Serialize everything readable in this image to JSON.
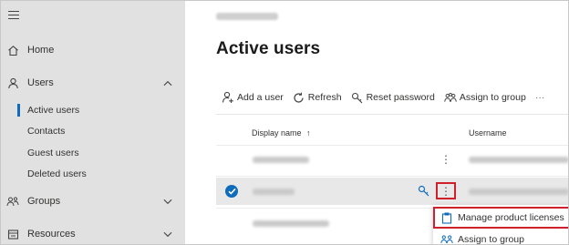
{
  "sidebar": {
    "items": [
      {
        "label": "Home",
        "icon": "home-icon"
      },
      {
        "label": "Users",
        "icon": "user-icon",
        "expanded": true
      },
      {
        "label": "Groups",
        "icon": "groups-icon",
        "expanded": false
      },
      {
        "label": "Resources",
        "icon": "resources-icon",
        "expanded": false
      }
    ],
    "user_subitems": [
      {
        "label": "Active users",
        "active": true
      },
      {
        "label": "Contacts"
      },
      {
        "label": "Guest users"
      },
      {
        "label": "Deleted users"
      }
    ]
  },
  "main": {
    "title": "Active users",
    "toolbar": {
      "add_user": "Add a user",
      "refresh": "Refresh",
      "reset_password": "Reset password",
      "assign_to_group": "Assign to group",
      "more": "···"
    },
    "columns": {
      "display_name": "Display name",
      "sort_indicator": "↑",
      "username": "Username"
    },
    "row_more": "⋮"
  },
  "context_menu": {
    "items": [
      {
        "label": "Manage product licenses",
        "icon": "license-icon"
      },
      {
        "label": "Assign to group",
        "icon": "assign-group-icon"
      }
    ]
  },
  "colors": {
    "accent": "#0f6cbd",
    "highlight": "#d0202c",
    "sidebar_bg": "#e1e1e1"
  }
}
